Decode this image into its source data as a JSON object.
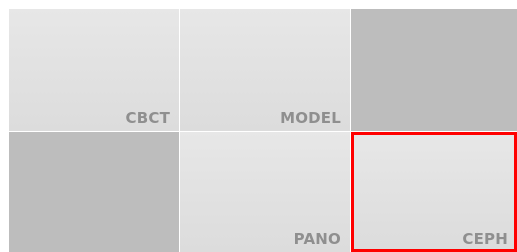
{
  "tiles": [
    {
      "id": "cbct",
      "label": "CBCT",
      "state": "available"
    },
    {
      "id": "model",
      "label": "MODEL",
      "state": "available"
    },
    {
      "id": "empty-1",
      "label": "",
      "state": "empty"
    },
    {
      "id": "empty-2",
      "label": "",
      "state": "empty"
    },
    {
      "id": "pano",
      "label": "PANO",
      "state": "available"
    },
    {
      "id": "ceph",
      "label": "CEPH",
      "state": "selected"
    }
  ],
  "colors": {
    "tile_light": "#e3e3e3",
    "tile_empty": "#bdbdbd",
    "label": "#8f8f8f",
    "selection": "#ff0000"
  }
}
